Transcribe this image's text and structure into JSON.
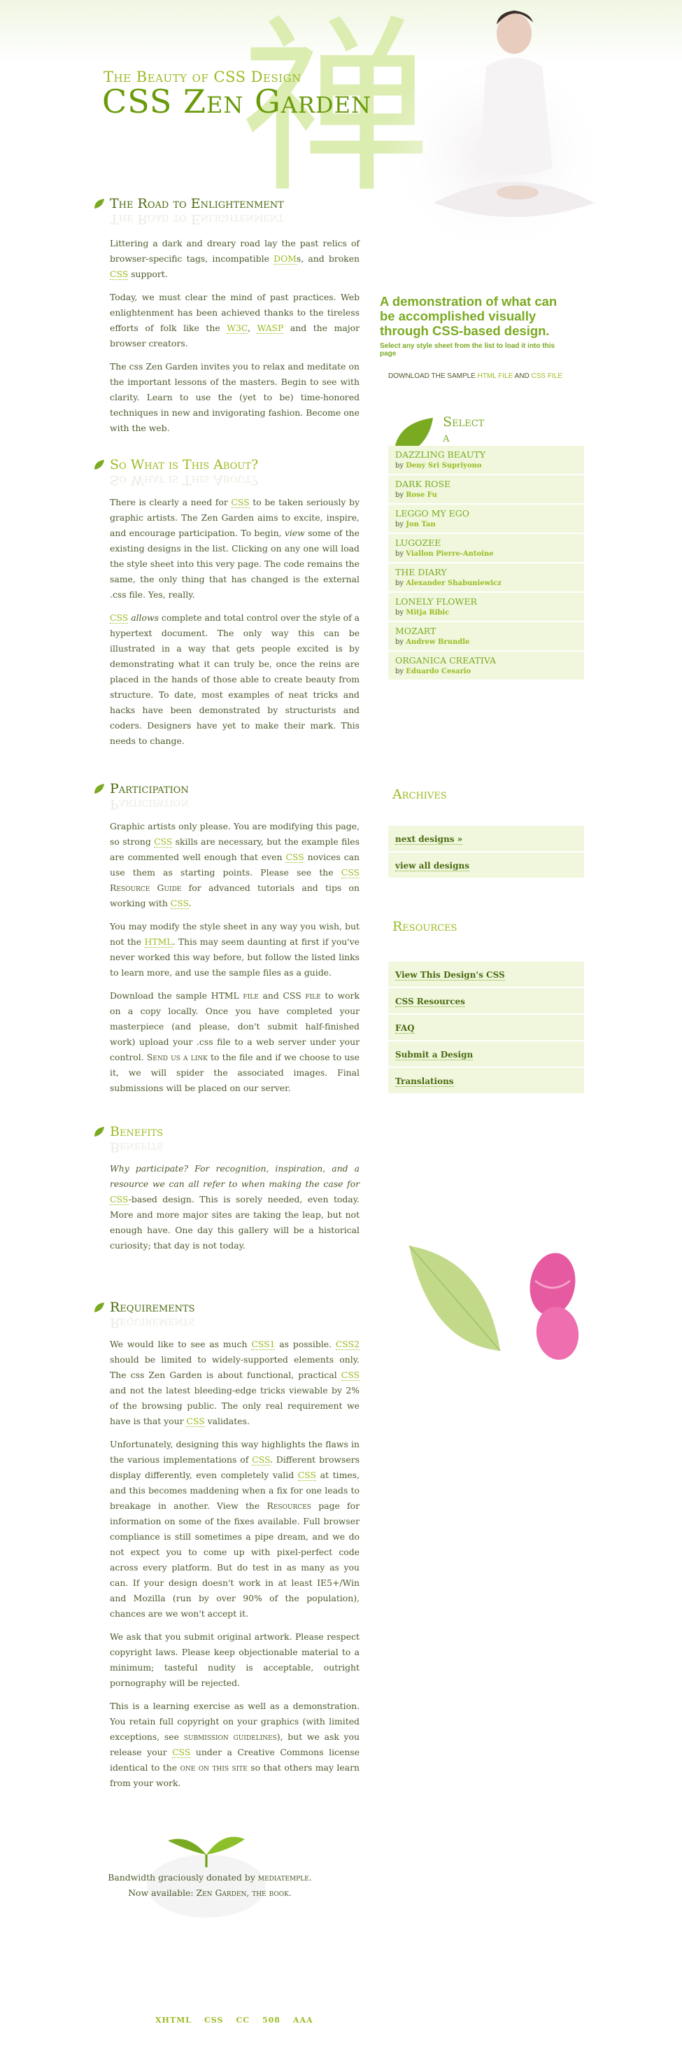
{
  "header": {
    "subtitle": "The Beauty of CSS Design",
    "title": "CSS Zen Garden",
    "kanji": "禅"
  },
  "sections": {
    "enlightenment": {
      "title": "The Road to Enlightenment",
      "p1_a": "Littering a dark and dreary road lay the past relics of browser-specific tags, incompatible ",
      "p1_dom": "DOM",
      "p1_b": "s, and broken ",
      "p1_css": "CSS",
      "p1_c": " support.",
      "p2_a": "Today, we must clear the mind of past practices. Web enlightenment has been achieved thanks to the tireless efforts of folk like the ",
      "p2_w3c": "W3C",
      "p2_b": ", ",
      "p2_wasp": "WASP",
      "p2_c": " and the major browser creators.",
      "p3": "The css Zen Garden invites you to relax and meditate on the important lessons of the masters. Begin to see with clarity. Learn to use the (yet to be) time-honored techniques in new and invigorating fashion. Become one with the web."
    },
    "about": {
      "title": "So What is This About?",
      "p1_a": "There is clearly a need for ",
      "p1_css": "CSS",
      "p1_b": " to be taken seriously by graphic artists. The Zen Garden aims to excite, inspire, and encourage participation. To begin, ",
      "p1_view": "view",
      "p1_c": " some of the existing designs in the list. Clicking on any one will load the style sheet into this very page. The code remains the same, the only thing that has changed is the external .css file. Yes, really.",
      "p2_css": "CSS",
      "p2_allows": "allows",
      "p2_a": " complete and total control over the style of a hypertext document. The only way this can be illustrated in a way that gets people excited is by demonstrating what it can truly be, once the reins are placed in the hands of those able to create beauty from structure. To date, most examples of neat tricks and hacks have been demonstrated by structurists and coders. Designers have yet to make their mark. This needs to change."
    },
    "participation": {
      "title": "Participation",
      "p1_a": "Graphic artists only please. You are modifying this page, so strong ",
      "p1_css1": "CSS",
      "p1_b": " skills are necessary, but the example files are commented well enough that even ",
      "p1_css2": "CSS",
      "p1_c": " novices can use them as starting points. Please see the ",
      "p1_css3": "CSS",
      "p1_guide": "Resource Guide",
      "p1_d": " for advanced tutorials and tips on working with ",
      "p1_css4": "CSS",
      "p1_e": ".",
      "p2_a": "You may modify the style sheet in any way you wish, but not the ",
      "p2_html": "HTML",
      "p2_b": ". This may seem daunting at first if you've never worked this way before, but follow the listed links to learn more, and use the sample files as a guide.",
      "p3_a": "Download the sample ",
      "p3_html": "HTML file",
      "p3_b": " and ",
      "p3_css": "CSS file",
      "p3_c": " to work on a copy locally. Once you have completed your masterpiece (and please, don't submit half-finished work) upload your .css file to a web server under your control. ",
      "p3_send": "Send us a link",
      "p3_d": " to the file and if we choose to use it, we will spider the associated images. Final submissions will be placed on our server."
    },
    "benefits": {
      "title": "Benefits",
      "p1_a": "Why participate? For recognition, inspiration, and a resource we can all refer to when making the case for ",
      "p1_css": "CSS",
      "p1_b": "-based design. This is sorely needed, even today. More and more major sites are taking the leap, but not enough have. One day this gallery will be a historical curiosity; that day is not today."
    },
    "requirements": {
      "title": "Requirements",
      "p1_a": "We would like to see as much ",
      "p1_css1": "CSS1",
      "p1_b": " as possible. ",
      "p1_css2": "CSS2",
      "p1_c": " should be limited to widely-supported elements only. The css Zen Garden is about functional, practical ",
      "p1_css3": "CSS",
      "p1_d": " and not the latest bleeding-edge tricks viewable by 2% of the browsing public. The only real requirement we have is that your ",
      "p1_css4": "CSS",
      "p1_e": " validates.",
      "p2_a": "Unfortunately, designing this way highlights the flaws in the various implementations of ",
      "p2_css1": "CSS",
      "p2_b": ". Different browsers display differently, even completely valid ",
      "p2_css2": "CSS",
      "p2_c": " at times, and this becomes maddening when a fix for one leads to breakage in another. View the ",
      "p2_res": "Resources",
      "p2_d": " page for information on some of the fixes available. Full browser compliance is still sometimes a pipe dream, and we do not expect you to come up with pixel-perfect code across every platform. But do test in as many as you can. If your design doesn't work in at least IE5+/Win and Mozilla (run by over 90% of the population), chances are we won't accept it.",
      "p3": "We ask that you submit original artwork. Please respect copyright laws. Please keep objectionable material to a minimum; tasteful nudity is acceptable, outright pornography will be rejected.",
      "p4_a": "This is a learning exercise as well as a demonstration. You retain full copyright on your graphics (with limited exceptions, see ",
      "p4_sub": "submission guidelines",
      "p4_b": "), but we ask you release your ",
      "p4_css": "CSS",
      "p4_c": " under a Creative Commons license identical to the ",
      "p4_one": "one on this site",
      "p4_d": " so that others may learn from your work."
    }
  },
  "sidebar": {
    "intro_big": "A demonstration of what can be accomplished visually through CSS-based design.",
    "intro_small": "Select any style sheet from the list to load it into this page",
    "download_a": "Download the sample ",
    "download_html": "html file",
    "download_and": " and ",
    "download_css": "css file",
    "select_title": "Select a Design",
    "by": "by",
    "designs": [
      {
        "name": "Dazzling Beauty",
        "author": "Deny Sri Supriyono"
      },
      {
        "name": "Dark Rose",
        "author": "Rose Fu"
      },
      {
        "name": "Leggo My Ego",
        "author": "Jon Tan"
      },
      {
        "name": "Lugozee",
        "author": "Viallon Pierre-Antoine"
      },
      {
        "name": "The Diary",
        "author": "Alexander Shabuniewicz"
      },
      {
        "name": "Lonely Flower",
        "author": "Mitja Ribic"
      },
      {
        "name": "Mozart",
        "author": "Andrew Brundle"
      },
      {
        "name": "Organica Creativa",
        "author": "Eduardo Cesario"
      }
    ],
    "archives_title": "Archives",
    "archives": [
      "next designs »",
      "view all designs"
    ],
    "resources_title": "Resources",
    "resources": [
      "View This Design's CSS",
      "CSS Resources",
      "FAQ",
      "Submit a Design",
      "Translations"
    ]
  },
  "footer": {
    "line1_a": "Bandwidth graciously donated by ",
    "line1_b": "mediatemple",
    "line1_c": ".",
    "line2_a": "Now available: ",
    "line2_b": "Zen Garden, the book",
    "line2_c": ".",
    "links": [
      "XHTML",
      "CSS",
      "CC",
      "508",
      "AAA"
    ]
  },
  "colors": {
    "accent": "#99bb22",
    "dark": "#4a6a10",
    "panel": "#f0f7dc"
  }
}
